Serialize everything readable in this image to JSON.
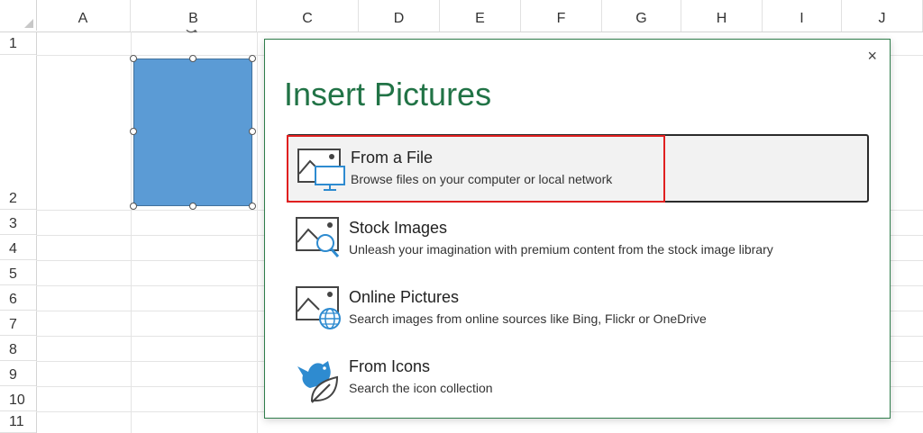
{
  "sheet": {
    "columns": [
      "A",
      "B",
      "C",
      "D",
      "E",
      "F",
      "G",
      "H",
      "I",
      "J"
    ],
    "rows": [
      "1",
      "2",
      "3",
      "4",
      "5",
      "6",
      "7",
      "8",
      "9",
      "10",
      "11"
    ]
  },
  "dialog": {
    "title": "Insert Pictures",
    "close_label": "×",
    "options": [
      {
        "title": "From a File",
        "subtitle": "Browse files on your computer or local network",
        "icon": "file-computer-icon",
        "selected": true
      },
      {
        "title": "Stock Images",
        "subtitle": "Unleash your imagination with premium content from the stock image library",
        "icon": "stock-images-icon",
        "selected": false
      },
      {
        "title": "Online Pictures",
        "subtitle": "Search images from online sources like Bing, Flickr or OneDrive",
        "icon": "online-pictures-icon",
        "selected": false
      },
      {
        "title": "From Icons",
        "subtitle": "Search the icon collection",
        "icon": "icons-collection-icon",
        "selected": false
      }
    ]
  },
  "colors": {
    "accent_green": "#217346",
    "shape_fill": "#5b9bd5",
    "highlight_red": "#e02020",
    "icon_blue": "#2e8bd0"
  }
}
